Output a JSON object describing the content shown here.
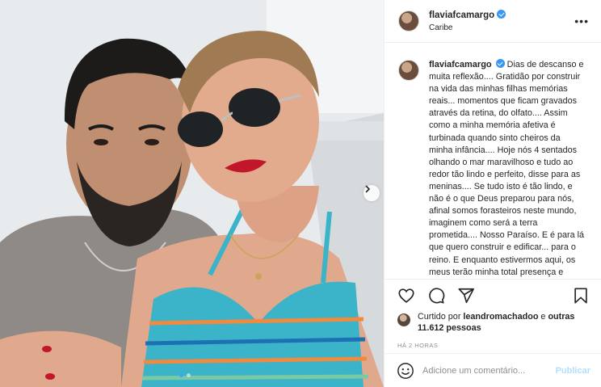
{
  "post": {
    "username": "flaviafcamargo",
    "location": "Caribe",
    "caption_text": "Dias de descanso e muita reflexão.... Gratidão por construir na vida das minhas filhas memórias reais... momentos que ficam gravados através da retina, do olfato.... Assim como a minha memória afetiva é turbinada quando sinto cheiros da minha infância.... Hoje nós 4 sentados olhando o mar maravilhoso e tudo ao redor tão lindo e perfeito, disse para as meninas.... Se tudo isto é tão lindo, e não é o que Deus preparou para nós, afinal somos forasteiros neste mundo, imaginem como será a terra prometida.... Nosso Paraíso. E é para lá que quero construir e edificar... para o reino. E enquanto estivermos aqui, os meus terão minha total presença e",
    "more_options_icon": "more-options-icon"
  },
  "likes": {
    "prefix": "Curtido por",
    "first_liker": "leandromachadoo",
    "conjunction": "e",
    "others": "outras 11.612 pessoas"
  },
  "timestamp": "HÁ 2 HORAS",
  "comment": {
    "placeholder": "Adicione um comentário...",
    "publish_label": "Publicar"
  },
  "carousel": {
    "slide_count": 2,
    "active_index": 0
  },
  "colors": {
    "verified": "#3897f0",
    "publish_disabled": "#b2dffc",
    "carousel_active_dot": "#3aa3ff",
    "border": "#efefef"
  },
  "icons": [
    "heart-icon",
    "comment-icon",
    "share-icon",
    "bookmark-icon",
    "emoji-icon",
    "chevron-right-icon",
    "verified-badge-icon"
  ]
}
